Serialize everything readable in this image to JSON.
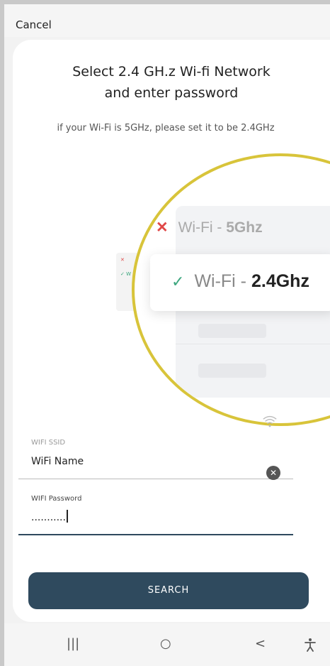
{
  "header": {
    "cancel_label": "Cancel"
  },
  "content": {
    "title": "Select 2.4 GH.z Wi-fi Network and enter password",
    "subtitle": "if your Wi-Fi is 5GHz, please set it to be 2.4GHz"
  },
  "illustration": {
    "row_5g": {
      "prefix": "Wi-Fi - ",
      "band": "5Ghz",
      "icon": "x-icon"
    },
    "row_24g": {
      "prefix": "Wi-Fi - ",
      "band": "2.4Ghz",
      "icon": "check-icon"
    },
    "mini_x": "✕",
    "mini_v": "✓ W",
    "accent": "#d8c43a"
  },
  "form": {
    "ssid_label": "WIFI SSID",
    "ssid_value": "WiFi Name",
    "password_label": "WIFI Password",
    "password_value": "...........",
    "clear_icon": "close-circle-icon"
  },
  "actions": {
    "search_label": "SEARCH",
    "button_color": "#2f4a5e"
  },
  "navbar": {
    "recents": "|||",
    "home": "○",
    "back": "<",
    "accessibility": "accessibility-icon"
  }
}
